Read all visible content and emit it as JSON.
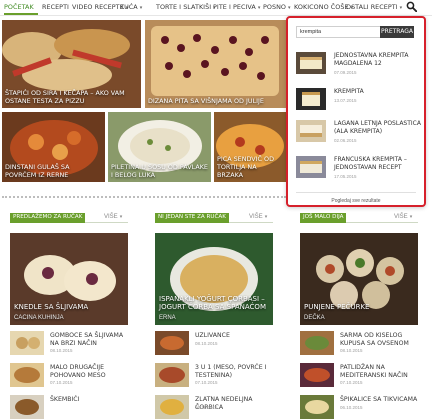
{
  "nav": {
    "items": [
      {
        "label": "Početak",
        "caret": false
      },
      {
        "label": "Recepti",
        "caret": false
      },
      {
        "label": "Video recepte",
        "caret": true
      },
      {
        "label": "Kuća",
        "caret": true
      },
      {
        "label": "Torte i slatkiši",
        "caret": true
      },
      {
        "label": "Pite i peciva",
        "caret": true
      },
      {
        "label": "Posno",
        "caret": true
      },
      {
        "label": "Kokicono čoše",
        "caret": true
      },
      {
        "label": "Ostali recepti",
        "caret": true
      }
    ],
    "caret_glyph": "▾",
    "search_icon": "search-icon"
  },
  "hero": [
    {
      "title": "Štapići od sira i kečapa – ako vam ostane testa za pizzu"
    },
    {
      "title": "Dizana pita sa višnjama od Julije"
    },
    {
      "title": "Dinstani gulaš sa povrćem iz rerne"
    },
    {
      "title": "Piletina u sosu od pavlake i belog luka"
    },
    {
      "title": "Pica sendvič od tortilja na brzaka"
    }
  ],
  "sections": [
    {
      "heading": "Predlažemo za ručak",
      "more": "Više",
      "featured": {
        "title": "Knedle sa šljivama",
        "author": "Cacina kuhinja"
      },
      "list": [
        {
          "title": "Gomboce sa šljivama na brzi način",
          "date": "08.10.2015"
        },
        {
          "title": "Malo drugačije pohovano meso",
          "date": "07.10.2015"
        },
        {
          "title": "Škembići",
          "date": "06.10.2015"
        }
      ]
    },
    {
      "heading": "Ni jedan ste za ručak",
      "more": "Više",
      "featured": {
        "title": "Ispanakli Yoğurt Çorbası – Jogurt čorba sa spanaćom",
        "author": "Erna"
      },
      "list": [
        {
          "title": "Uzlivance",
          "date": "08.10.2015"
        },
        {
          "title": "3 u 1 (meso, povrće i testenina)",
          "date": "07.10.2015"
        },
        {
          "title": "Zlatna nedeljna čorbica",
          "date": "06.10.2015"
        }
      ]
    },
    {
      "heading": "Još malo dija",
      "more": "Više",
      "featured": {
        "title": "Punjene pečurke",
        "author": "Dečka"
      },
      "list": [
        {
          "title": "Sarma od kiselog kupusa sa ovsenom",
          "date": "08.10.2015"
        },
        {
          "title": "Patlidžan na mediteranski način",
          "date": "07.10.2015"
        },
        {
          "title": "Špikalice sa tikvicama",
          "date": "06.10.2015"
        }
      ]
    }
  ],
  "search": {
    "value": "krempita",
    "button": "Pretraga",
    "results": [
      {
        "title": "Jednostavna krempita Magdalena 12",
        "date": "07.09.2015"
      },
      {
        "title": "Krempita",
        "date": "13.07.2015"
      },
      {
        "title": "Lagana letnja poslastica (ala krempita)",
        "date": "02.06.2015"
      },
      {
        "title": "Francuska krempita – jednostavan recept",
        "date": "17.05.2015"
      }
    ],
    "view_all": "Pogledaj sve rezultate"
  },
  "colors": {
    "accent": "#6a9f2c",
    "popup_border": "#d6202b"
  }
}
